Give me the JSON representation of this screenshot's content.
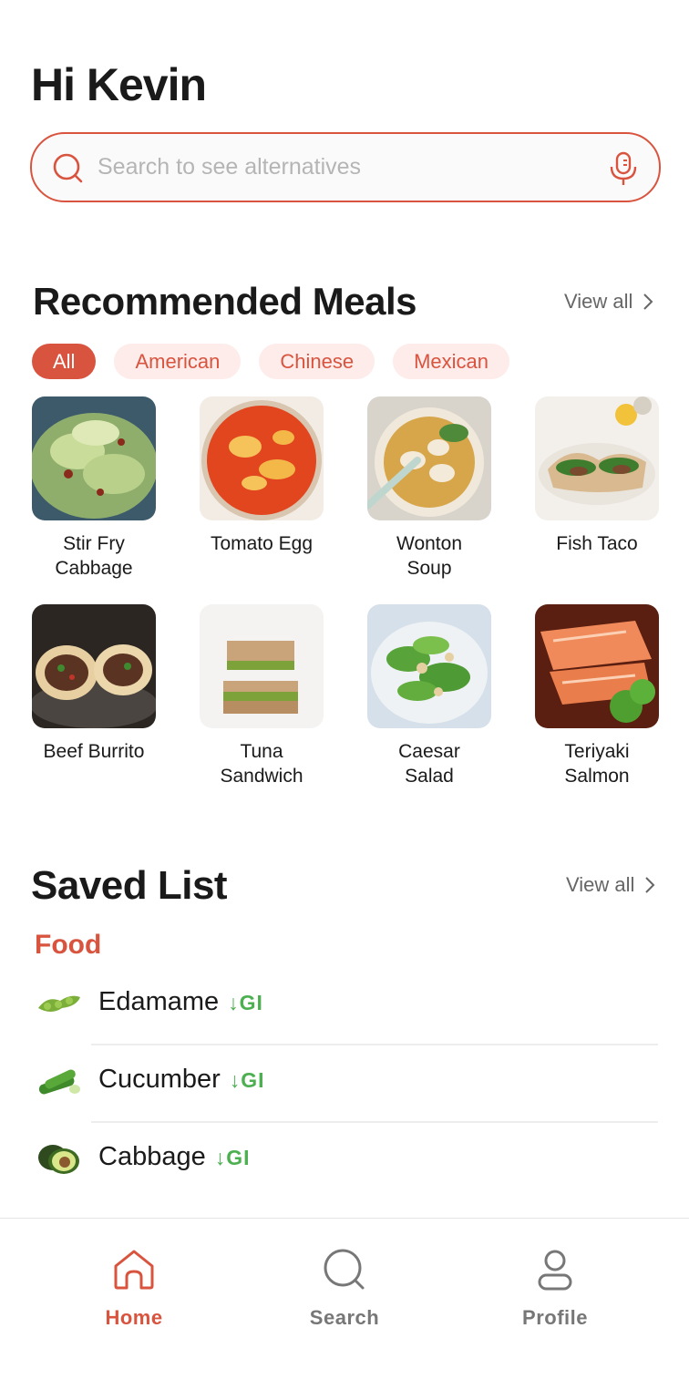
{
  "greeting": "Hi Kevin",
  "search": {
    "placeholder": "Search to see alternatives"
  },
  "recommended": {
    "title": "Recommended Meals",
    "view_all": "View all",
    "filters": [
      "All",
      "American",
      "Chinese",
      "Mexican"
    ],
    "meals": [
      {
        "name": "Stir Fry Cabbage"
      },
      {
        "name": "Tomato Egg"
      },
      {
        "name": "Wonton Soup"
      },
      {
        "name": "Fish Taco"
      },
      {
        "name": "Beef Burrito"
      },
      {
        "name": "Tuna Sandwich"
      },
      {
        "name": "Caesar Salad"
      },
      {
        "name": "Teriyaki Salmon"
      }
    ]
  },
  "saved": {
    "title": "Saved List",
    "view_all": "View all",
    "category": "Food",
    "items": [
      {
        "name": "Edamame",
        "tag": "↓GI",
        "icon": "edamame-icon"
      },
      {
        "name": "Cucumber",
        "tag": "↓GI",
        "icon": "cucumber-icon"
      },
      {
        "name": "Cabbage",
        "tag": "↓GI",
        "icon": "avocado-icon"
      }
    ]
  },
  "tabs": [
    {
      "label": "Home",
      "icon": "home-icon",
      "active": true
    },
    {
      "label": "Search",
      "icon": "search-icon",
      "active": false
    },
    {
      "label": "Profile",
      "icon": "profile-icon",
      "active": false
    }
  ],
  "colors": {
    "accent": "#d9543f",
    "chip_bg": "#fdecea",
    "gi_green": "#4caf50"
  }
}
